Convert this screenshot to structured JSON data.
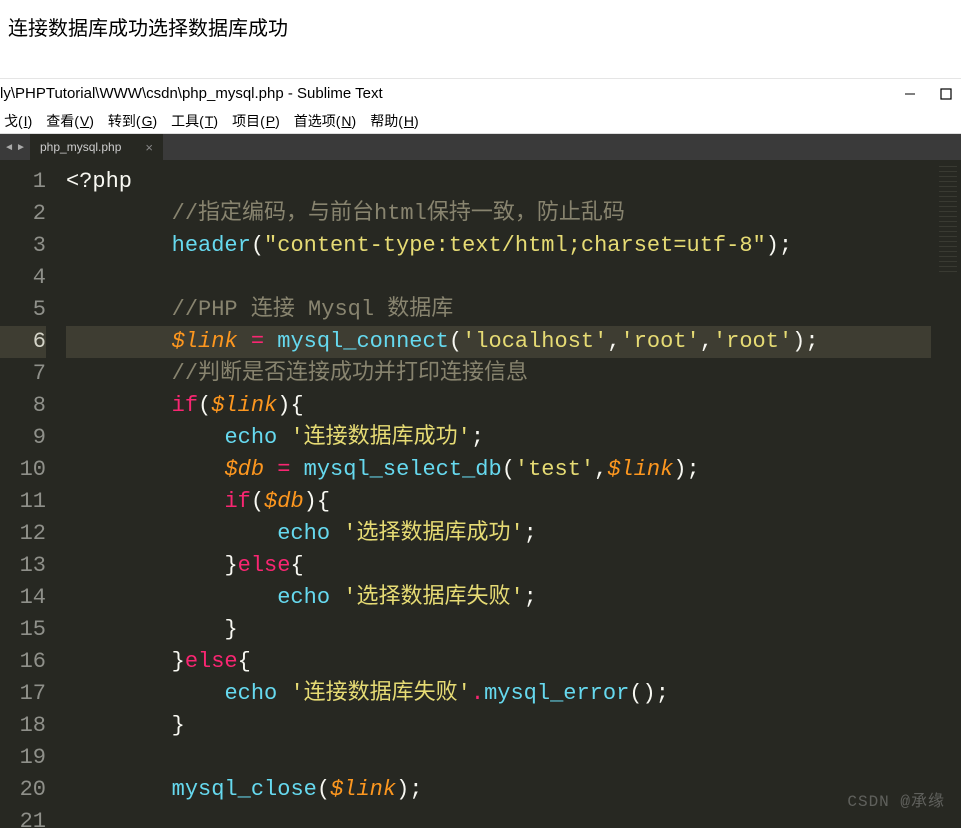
{
  "browser_output": "连接数据库成功选择数据库成功",
  "titlebar": {
    "path": "ly\\PHPTutorial\\WWW\\csdn\\php_mysql.php - Sublime Text"
  },
  "menu": {
    "items": [
      {
        "label": "戈",
        "accel": "I"
      },
      {
        "label": "查看",
        "accel": "V"
      },
      {
        "label": "转到",
        "accel": "G"
      },
      {
        "label": "工具",
        "accel": "T"
      },
      {
        "label": "项目",
        "accel": "P"
      },
      {
        "label": "首选项",
        "accel": "N"
      },
      {
        "label": "帮助",
        "accel": "H"
      }
    ]
  },
  "tab": {
    "name": "php_mysql.php"
  },
  "gutter": {
    "lines": 21,
    "active": 6
  },
  "code": {
    "l1": {
      "open": "<?php"
    },
    "l2": {
      "indent": "        ",
      "cmt": "//指定编码，与前台html保持一致，防止乱码"
    },
    "l3": {
      "indent": "        ",
      "fn": "header",
      "p1": "(",
      "s": "\"content-type:text/html;charset=utf-8\"",
      "p2": ");"
    },
    "l4": {
      "blank": ""
    },
    "l5": {
      "indent": "        ",
      "cmt": "//PHP 连接 Mysql 数据库"
    },
    "l6": {
      "indent": "        ",
      "v": "$link",
      "sp1": " ",
      "op": "=",
      "sp2": " ",
      "fn": "mysql_connect",
      "p1": "(",
      "s1": "'localhost'",
      "c1": ",",
      "s2": "'root'",
      "c2": ",",
      "s3": "'root'",
      "p2": ");"
    },
    "l7": {
      "indent": "        ",
      "cmt": "//判断是否连接成功并打印连接信息"
    },
    "l8": {
      "indent": "        ",
      "kw": "if",
      "p1": "(",
      "v": "$link",
      "p2": "){"
    },
    "l9": {
      "indent": "            ",
      "fn": "echo",
      "sp": " ",
      "s": "'连接数据库成功'",
      "p": ";"
    },
    "l10": {
      "indent": "            ",
      "v": "$db",
      "sp1": " ",
      "op": "=",
      "sp2": " ",
      "fn": "mysql_select_db",
      "p1": "(",
      "s": "'test'",
      "c": ",",
      "v2": "$link",
      "p2": ");"
    },
    "l11": {
      "indent": "            ",
      "kw": "if",
      "p1": "(",
      "v": "$db",
      "p2": "){"
    },
    "l12": {
      "indent": "                ",
      "fn": "echo",
      "sp": " ",
      "s": "'选择数据库成功'",
      "p": ";"
    },
    "l13": {
      "indent": "            ",
      "p": "}",
      "kw": "else",
      "p2": "{"
    },
    "l14": {
      "indent": "                ",
      "fn": "echo",
      "sp": " ",
      "s": "'选择数据库失败'",
      "p": ";"
    },
    "l15": {
      "indent": "            ",
      "p": "}"
    },
    "l16": {
      "indent": "        ",
      "p": "}",
      "kw": "else",
      "p2": "{"
    },
    "l17": {
      "indent": "            ",
      "fn": "echo",
      "sp": " ",
      "s": "'连接数据库失败'",
      "dot": ".",
      "fn2": "mysql_error",
      "p": "();"
    },
    "l18": {
      "indent": "        ",
      "p": "}"
    },
    "l19": {
      "blank": ""
    },
    "l20": {
      "indent": "        ",
      "fn": "mysql_close",
      "p1": "(",
      "v": "$link",
      "p2": ");"
    }
  },
  "watermark": "CSDN  @承缘"
}
